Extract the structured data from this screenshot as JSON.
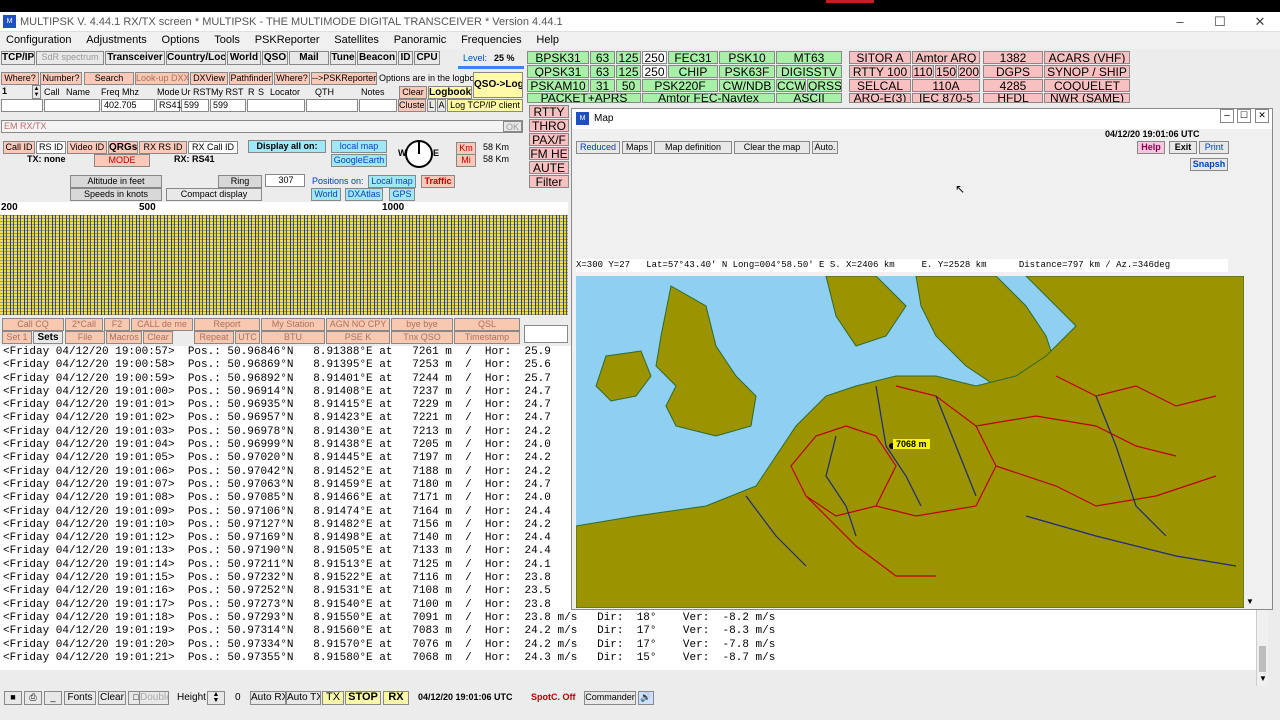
{
  "window": {
    "title": "MULTIPSK V. 4.44.1       RX/TX screen  * MULTIPSK - THE MULTIMODE DIGITAL TRANSCEIVER *   Version 4.44.1"
  },
  "menu": [
    "Configuration",
    "Adjustments",
    "Options",
    "Tools",
    "PSKReporter",
    "Satellites",
    "Panoramic",
    "Frequencies",
    "Help"
  ],
  "toolbar1": [
    "TCP/IP",
    "SdR spectrum",
    "Transceiver",
    "Country/Loc",
    "World",
    "QSO",
    "Mail",
    "Tune",
    "Beacon",
    "ID",
    "CPU"
  ],
  "level": {
    "label": "Level:",
    "value": "25 %"
  },
  "toolbar2": [
    "Where?",
    "Number?",
    "Search",
    "Look-up DXX",
    "DXView",
    "Pathfinder",
    "Where?",
    "-->PSKReporter"
  ],
  "options_note": "Options are in the logbo",
  "qso_log": "QSO->Log",
  "log_headers": [
    "Call",
    "Name",
    "Freq Mhz",
    "Mode",
    "Ur RST",
    "My RST",
    "R",
    "S",
    "Locator",
    "QTH",
    "Notes"
  ],
  "log_values": {
    "num": "1",
    "freq": "402.705",
    "mode": "RS41",
    "ur_rst": "599",
    "my_rst": "599"
  },
  "clear": "Clear",
  "logbook": "Logbook",
  "cluster": "Cluster",
  "la": "L",
  "aa": "A",
  "log_tcp": "Log TCP/IP client",
  "modes": [
    [
      "BPSK31",
      "63",
      "125",
      "250",
      "FEC31",
      "PSK10",
      "MT63"
    ],
    [
      "QPSK31",
      "63",
      "125",
      "250",
      "CHIP",
      "PSK63F",
      "DIGISSTV"
    ],
    [
      "PSKAM10",
      "31",
      "50",
      "PSK220F",
      "CW/NDB",
      "CCW",
      "QRSS"
    ],
    [
      "PACKET+APRS",
      "Amtor FEC-Navtex",
      "ASCII"
    ]
  ],
  "modes_right": [
    [
      "SITOR A",
      "Amtor ARQ",
      "1382",
      "ACARS (VHF)"
    ],
    [
      "RTTY 100",
      "110",
      "150",
      "200",
      "DGPS",
      "SYNOP / SHIP"
    ],
    [
      "SELCAL",
      "110A",
      "4285",
      "COQUELET"
    ],
    [
      "ARQ-E(3)",
      "IEC 870-5",
      "HFDL",
      "NWR (SAME)"
    ]
  ],
  "side_modes": [
    "RTTY",
    "THRO",
    "PAX/F",
    "FM HE",
    "AUTE",
    "Filter"
  ],
  "em_rxtx": "EM RX/TX",
  "ok": "OK",
  "id_buttons": [
    "Call ID",
    "RS ID",
    "Video ID",
    "QRGs",
    "RX RS ID",
    "RX Call ID"
  ],
  "tx_none": "TX: none",
  "mode_btn": "MODE",
  "rx_mode": "RX: RS41",
  "display_all": "Display all on:",
  "local_map": "local map",
  "google_earth": "GoogleEarth",
  "compass": {
    "w": "W",
    "e": "E"
  },
  "units": {
    "km": "Km",
    "mi": "Mi",
    "km_val": "58 Km",
    "mi_val": "58 Km"
  },
  "alt_feet": "Altitude in feet",
  "speed_knots": "Speeds in knots",
  "compact": "Compact display",
  "ring": "Ring",
  "ring_val": "307",
  "positions_on": "Positions on:",
  "localmap2": "Local map",
  "traffic": "Traffic",
  "world": "World",
  "dxatlas": "DXAtlas",
  "gps": "GPS",
  "ruler": [
    "200",
    "500",
    "1000"
  ],
  "macro_row1": [
    "Call CQ",
    "2*Call",
    "F2",
    "CALL de me",
    "Report",
    "My Station",
    "AGN NO CPY",
    "bye bye",
    "QSL"
  ],
  "macro_row2": [
    "Set 1",
    "Sets",
    "File",
    "Macros",
    "Clear",
    "Repeat",
    "UTC",
    "BTU",
    "PSE K",
    "Tnx QSO",
    "Timestamp"
  ],
  "log_lines": [
    "<Friday 04/12/20 19:00:57>  Pos.: 50.96846°N   8.91388°E at   7261 m  /  Hor:  25.9",
    "<Friday 04/12/20 19:00:58>  Pos.: 50.96869°N   8.91395°E at   7253 m  /  Hor:  25.6",
    "<Friday 04/12/20 19:00:59>  Pos.: 50.96892°N   8.91401°E at   7244 m  /  Hor:  25.7",
    "<Friday 04/12/20 19:01:00>  Pos.: 50.96914°N   8.91408°E at   7237 m  /  Hor:  24.7",
    "<Friday 04/12/20 19:01:01>  Pos.: 50.96935°N   8.91415°E at   7229 m  /  Hor:  24.7",
    "<Friday 04/12/20 19:01:02>  Pos.: 50.96957°N   8.91423°E at   7221 m  /  Hor:  24.7",
    "<Friday 04/12/20 19:01:03>  Pos.: 50.96978°N   8.91430°E at   7213 m  /  Hor:  24.2",
    "<Friday 04/12/20 19:01:04>  Pos.: 50.96999°N   8.91438°E at   7205 m  /  Hor:  24.0",
    "<Friday 04/12/20 19:01:05>  Pos.: 50.97020°N   8.91445°E at   7197 m  /  Hor:  24.2",
    "<Friday 04/12/20 19:01:06>  Pos.: 50.97042°N   8.91452°E at   7188 m  /  Hor:  24.2",
    "<Friday 04/12/20 19:01:07>  Pos.: 50.97063°N   8.91459°E at   7180 m  /  Hor:  24.7",
    "<Friday 04/12/20 19:01:08>  Pos.: 50.97085°N   8.91466°E at   7171 m  /  Hor:  24.0",
    "<Friday 04/12/20 19:01:09>  Pos.: 50.97106°N   8.91474°E at   7164 m  /  Hor:  24.4",
    "<Friday 04/12/20 19:01:10>  Pos.: 50.97127°N   8.91482°E at   7156 m  /  Hor:  24.2",
    "<Friday 04/12/20 19:01:12>  Pos.: 50.97169°N   8.91498°E at   7140 m  /  Hor:  24.4",
    "<Friday 04/12/20 19:01:13>  Pos.: 50.97190°N   8.91505°E at   7133 m  /  Hor:  24.4",
    "<Friday 04/12/20 19:01:14>  Pos.: 50.97211°N   8.91513°E at   7125 m  /  Hor:  24.1",
    "<Friday 04/12/20 19:01:15>  Pos.: 50.97232°N   8.91522°E at   7116 m  /  Hor:  23.8",
    "<Friday 04/12/20 19:01:16>  Pos.: 50.97252°N   8.91531°E at   7108 m  /  Hor:  23.5",
    "<Friday 04/12/20 19:01:17>  Pos.: 50.97273°N   8.91540°E at   7100 m  /  Hor:  23.8",
    "<Friday 04/12/20 19:01:18>  Pos.: 50.97293°N   8.91550°E at   7091 m  /  Hor:  23.8 m/s   Dir:  18°    Ver:  -8.2 m/s",
    "<Friday 04/12/20 19:01:19>  Pos.: 50.97314°N   8.91560°E at   7083 m  /  Hor:  24.2 m/s   Dir:  17°    Ver:  -8.3 m/s",
    "<Friday 04/12/20 19:01:20>  Pos.: 50.97334°N   8.91570°E at   7076 m  /  Hor:  24.2 m/s   Dir:  17°    Ver:  -7.8 m/s",
    "<Friday 04/12/20 19:01:21>  Pos.: 50.97355°N   8.91580°E at   7068 m  /  Hor:  24.3 m/s   Dir:  15°    Ver:  -8.7 m/s"
  ],
  "bottom": {
    "fonts": "Fonts",
    "clear": "Clear",
    "double": "Double",
    "height": "Height",
    "zero": "0",
    "auto_rx": "Auto RX",
    "auto_tx": "Auto TX",
    "tx": "TX",
    "stop": "STOP",
    "rx": "RX",
    "time": "04/12/20 19:01:06 UTC",
    "spotc": "SpotC. Off",
    "commander": "Commander"
  },
  "map": {
    "title": "Map",
    "time": "04/12/20 19:01:06 UTC",
    "buttons": [
      "Reduced",
      "Maps",
      "Map definition",
      "Clear the map",
      "Auto."
    ],
    "help": "Help",
    "exit": "Exit",
    "print": "Print",
    "snapsh": "Snapsh",
    "info": "X=300 Y=27   Lat=57°43.40' N Long=004°58.50' E S. X=2406 km     E. Y=2528 km      Distance=797 km / Az.=346deg",
    "marker": "7068 m"
  }
}
